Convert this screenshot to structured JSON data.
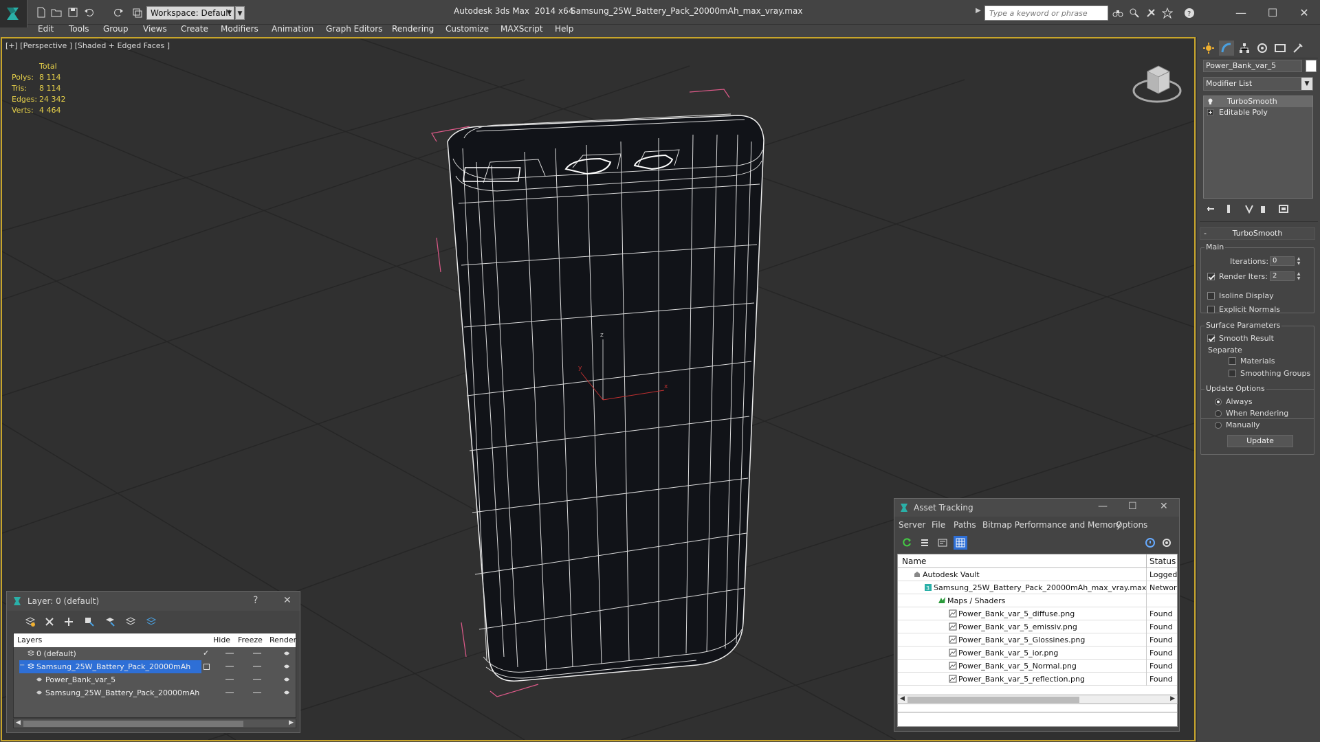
{
  "window": {
    "app_title": "Autodesk 3ds Max  2014 x64",
    "file_title": "Samsung_25W_Battery_Pack_20000mAh_max_vray.max",
    "workspace": "Workspace: Default",
    "search_placeholder": "Type a keyword or phrase"
  },
  "menu": [
    "Edit",
    "Tools",
    "Group",
    "Views",
    "Create",
    "Modifiers",
    "Animation",
    "Graph Editors",
    "Rendering",
    "Customize",
    "MAXScript",
    "Help"
  ],
  "viewport": {
    "label": "[+] [Perspective ] [Shaded + Edged Faces ]",
    "stats": {
      "header": "Total",
      "rows": [
        {
          "label": "Polys:",
          "value": "8 114"
        },
        {
          "label": "Tris:",
          "value": "8 114"
        },
        {
          "label": "Edges:",
          "value": "24 342"
        },
        {
          "label": "Verts:",
          "value": "4 464"
        }
      ]
    },
    "axes": {
      "x": "x",
      "y": "y",
      "z": "z"
    }
  },
  "command_panel": {
    "object_name": "Power_Bank_var_5",
    "modifier_list": "Modifier List",
    "stack": [
      "TurboSmooth",
      "Editable Poly"
    ],
    "rollout_title": "TurboSmooth",
    "main_group": "Main",
    "iterations_label": "Iterations:",
    "iterations_value": "0",
    "render_iters_label": "Render Iters:",
    "render_iters_value": "2",
    "isoline_label": "Isoline Display",
    "explicit_normals_label": "Explicit Normals",
    "surface_group": "Surface Parameters",
    "smooth_result_label": "Smooth Result",
    "separate_label": "Separate",
    "materials_label": "Materials",
    "smoothing_groups_label": "Smoothing Groups",
    "update_group": "Update Options",
    "always_label": "Always",
    "when_rendering_label": "When Rendering",
    "manually_label": "Manually",
    "update_button": "Update",
    "render_iters_checked": true,
    "smooth_result_checked": true,
    "update_mode": "Always"
  },
  "layer_window": {
    "title": "Layer: 0 (default)",
    "help": "?",
    "columns": {
      "layers": "Layers",
      "hide": "Hide",
      "freeze": "Freeze",
      "render": "Render"
    },
    "rows": [
      {
        "name": "0 (default)",
        "indent": 0,
        "selected": false
      },
      {
        "name": "Samsung_25W_Battery_Pack_20000mAh",
        "indent": 0,
        "selected": true
      },
      {
        "name": "Power_Bank_var_5",
        "indent": 1,
        "selected": false
      },
      {
        "name": "Samsung_25W_Battery_Pack_20000mAh",
        "indent": 1,
        "selected": false
      }
    ]
  },
  "asset_tracking": {
    "title": "Asset Tracking",
    "menu": [
      "Server",
      "File",
      "Paths",
      "Bitmap Performance and Memory",
      "Options"
    ],
    "columns": {
      "name": "Name",
      "status": "Status"
    },
    "rows": [
      {
        "name": "Autodesk Vault",
        "status": "Logged",
        "indent": 0,
        "icon": "vault-icon"
      },
      {
        "name": "Samsung_25W_Battery_Pack_20000mAh_max_vray.max",
        "status": "Networ",
        "indent": 1,
        "icon": "max-file-icon"
      },
      {
        "name": "Maps / Shaders",
        "status": "",
        "indent": 2,
        "icon": "maps-icon"
      },
      {
        "name": "Power_Bank_var_5_diffuse.png",
        "status": "Found",
        "indent": 3,
        "icon": "bitmap-icon"
      },
      {
        "name": "Power_Bank_var_5_emissiv.png",
        "status": "Found",
        "indent": 3,
        "icon": "bitmap-icon"
      },
      {
        "name": "Power_Bank_var_5_Glossines.png",
        "status": "Found",
        "indent": 3,
        "icon": "bitmap-icon"
      },
      {
        "name": "Power_Bank_var_5_ior.png",
        "status": "Found",
        "indent": 3,
        "icon": "bitmap-icon"
      },
      {
        "name": "Power_Bank_var_5_Normal.png",
        "status": "Found",
        "indent": 3,
        "icon": "bitmap-icon"
      },
      {
        "name": "Power_Bank_var_5_reflection.png",
        "status": "Found",
        "indent": 3,
        "icon": "bitmap-icon"
      }
    ]
  },
  "colors": {
    "viewport_border": "#c8a52a",
    "stats_text": "#e8d24a",
    "selection": "#2e6fd6",
    "wire": "#ffffff",
    "bbox": "#e05a8a"
  }
}
